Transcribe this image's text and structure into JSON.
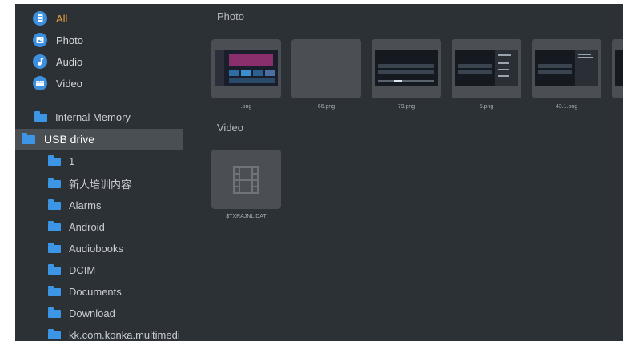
{
  "categories": [
    {
      "label": "All",
      "icon": "document-icon",
      "active": true
    },
    {
      "label": "Photo",
      "icon": "photo-icon",
      "active": false
    },
    {
      "label": "Audio",
      "icon": "music-note-icon",
      "active": false
    },
    {
      "label": "Video",
      "icon": "video-icon",
      "active": false
    }
  ],
  "storage": {
    "internal_label": "Internal Memory",
    "usb_label": "USB drive"
  },
  "folders": [
    "1",
    "新人培训内容",
    "Alarms",
    "Android",
    "Audiobooks",
    "DCIM",
    "Documents",
    "Download",
    "kk.com.konka.multimedi"
  ],
  "photo_section": {
    "title": "Photo",
    "items": [
      ".png",
      "66.png",
      "79.png",
      "5.png",
      "43.1.png"
    ]
  },
  "video_section": {
    "title": "Video",
    "items": [
      "$TXRAJNL.DAT"
    ]
  },
  "colors": {
    "background": "#2c3135",
    "selected_row": "#4a4f53",
    "active_text": "#e9a23b",
    "icon_blue": "#3d95e6"
  }
}
